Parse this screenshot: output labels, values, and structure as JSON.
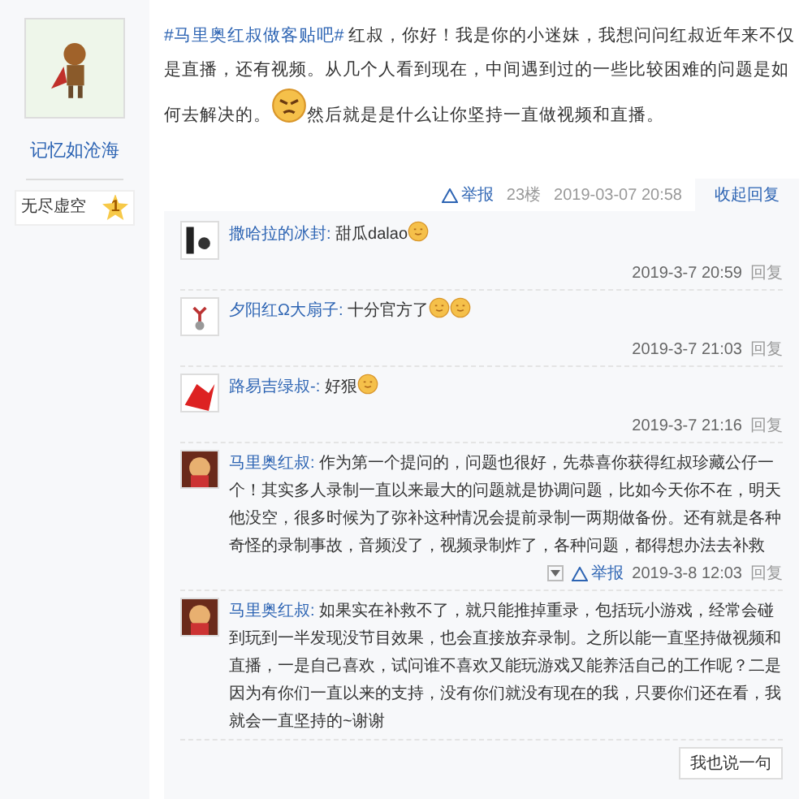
{
  "author": {
    "name": "记忆如沧海",
    "badge": {
      "label": "无尽虚空",
      "level": "1"
    }
  },
  "post": {
    "topic": "#马里奥红叔做客贴吧#",
    "text": " 红叔，你好！我是你的小迷妹，我想问问红叔近年来不仅是直播，还有视频。从几个人看到现在，中间遇到过的一些比较困难的问题是如何去解决的。",
    "emoji_then": "然后就是是什么让你坚持一直做视频和直播。"
  },
  "post_tail": {
    "report": "举报",
    "floor": "23楼",
    "time": "2019-03-07 20:58",
    "collapse": "收起回复"
  },
  "replies": [
    {
      "user": "撒哈拉的冰封:",
      "text": " 甜瓜dalao",
      "emojis": [
        {
          "kind": "smile"
        }
      ],
      "time": "2019-3-7 20:59",
      "reply": "回复"
    },
    {
      "user": "夕阳红Ω大扇子:",
      "text": " 十分官方了",
      "emojis": [
        {
          "kind": "smile"
        },
        {
          "kind": "smile"
        }
      ],
      "time": "2019-3-7 21:03",
      "reply": "回复"
    },
    {
      "user": "路易吉绿叔-:",
      "text": " 好狠",
      "emojis": [
        {
          "kind": "smile"
        }
      ],
      "time": "2019-3-7 21:16",
      "reply": "回复"
    },
    {
      "user": "马里奥红叔:",
      "text": " 作为第一个提问的，问题也很好，先恭喜你获得红叔珍藏公仔一个！其实多人录制一直以来最大的问题就是协调问题，比如今天你不在，明天他没空，很多时候为了弥补这种情况会提前录制一两期做备份。还有就是各种奇怪的录制事故，音频没了，视频录制炸了，各种问题，都得想办法去补救",
      "time": "2019-3-8 12:03",
      "reply": "回复",
      "report": "举报"
    },
    {
      "user": "马里奥红叔:",
      "text": " 如果实在补救不了，就只能推掉重录，包括玩小游戏，经常会碰到玩到一半发现没节目效果，也会直接放弃录制。之所以能一直坚持做视频和直播，一是自己喜欢，试问谁不喜欢又能玩游戏又能养活自己的工作呢？二是因为有你们一直以来的支持，没有你们就没有现在的我，只要你们还在看，我就会一直坚持的~谢谢"
    }
  ],
  "say_button": "我也说一句"
}
